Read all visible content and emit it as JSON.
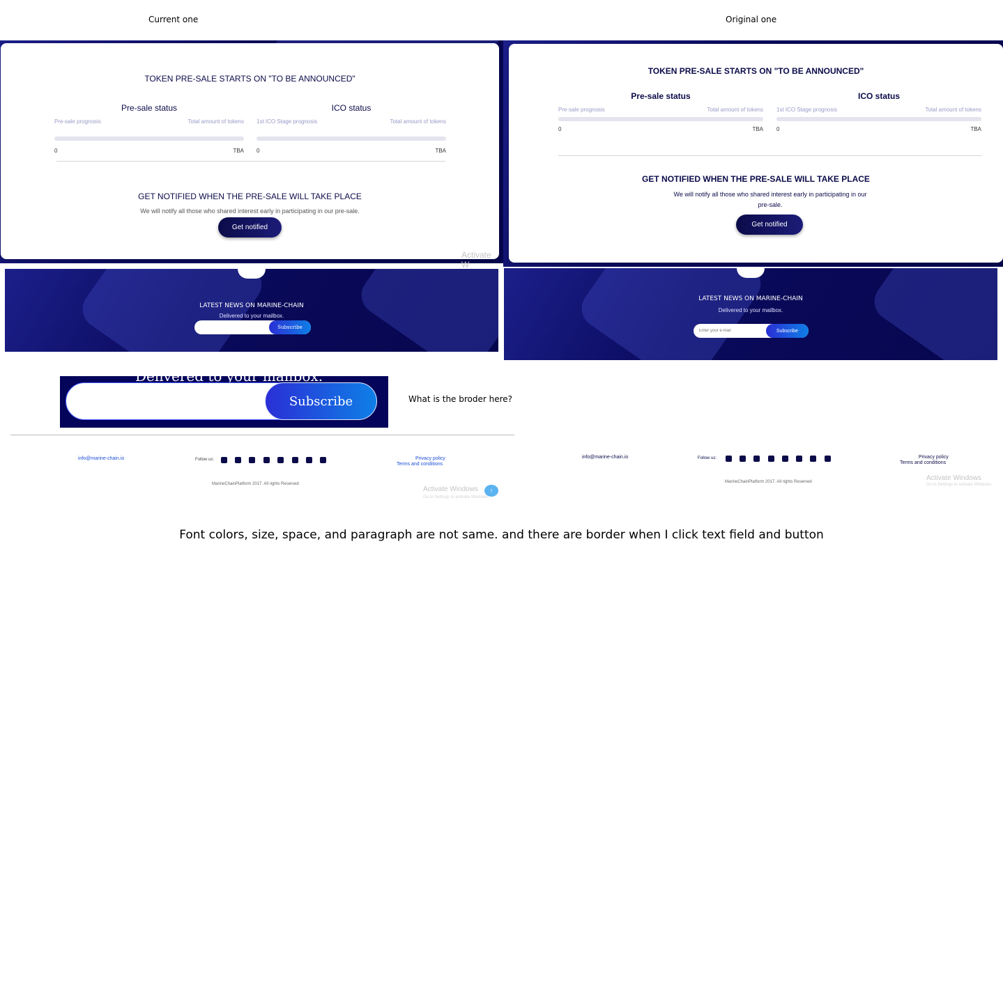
{
  "labels": {
    "current": "Current one",
    "original": "Original one"
  },
  "current": {
    "token_title": "TOKEN PRE-SALE STARTS ON \"TO BE ANNOUNCED\"",
    "presale": {
      "name": "Pre-sale status",
      "left": "Pre-sale prognosis",
      "right": "Total amount of tokens",
      "start": "0",
      "end": "TBA"
    },
    "ico": {
      "name": "ICO status",
      "left": "1st ICO Stage prognosis",
      "right": "Total amount of tokens",
      "start": "0",
      "end": "TBA"
    },
    "notify_title": "GET NOTIFIED WHEN THE PRE-SALE WILL TAKE PLACE",
    "notify_text": "We will notify all those who shared interest early in participating in our pre-sale.",
    "notify_button": "Get notified",
    "watermark": "Activate W",
    "news_title": "LATEST NEWS ON MARINE-CHAIN",
    "news_sub": "Delivered to your mailbox.",
    "subscribe": "Subscribe",
    "footer": {
      "email": "info@marine-chain.io",
      "follow": "Follow us:",
      "privacy": "Privacy policy",
      "terms": "Terms and conditions",
      "copyright": "MarineChainPlatform 2017. All rights Reserved",
      "watermark": "Activate Windows",
      "watermark_sub": "Go to Settings to activate Windows.",
      "badge": "↑"
    }
  },
  "original": {
    "token_title": "TOKEN PRE-SALE STARTS ON \"TO BE ANNOUNCED\"",
    "presale": {
      "name": "Pre-sale status",
      "left": "Pre-sale prognosis",
      "right": "Total amount of tokens",
      "start": "0",
      "end": "TBA"
    },
    "ico": {
      "name": "ICO status",
      "left": "1st ICO Stage prognosis",
      "right": "Total amount of tokens",
      "start": "0",
      "end": "TBA"
    },
    "notify_title": "GET NOTIFIED WHEN THE PRE-SALE WILL TAKE PLACE",
    "notify_text": "We will notify all those who shared interest early in participating in our pre-sale.",
    "notify_button": "Get notified",
    "news_title": "LATEST NEWS ON MARINE-CHAIN",
    "news_sub": "Delivered to your mailbox.",
    "input_placeholder": "Enter your e-mail",
    "subscribe": "Subscribe",
    "footer": {
      "email": "info@marine-chain.io",
      "follow": "Follow us:",
      "privacy": "Privacy policy",
      "terms": "Terms and conditions",
      "copyright": "MarineChainPlatform 2017. All rights Reserved",
      "watermark": "Activate Windows",
      "watermark_sub": "Go to Settings to activate Windows."
    }
  },
  "zoom": {
    "text": "Delivered to your mailbox.",
    "subscribe": "Subscribe"
  },
  "question": "What is the broder here?",
  "caption": "Font colors, size, space, and paragraph are not same. and there are border when I click text field and button",
  "social_icons": [
    "linkedin-icon",
    "medium-icon",
    "twitter-icon",
    "facebook-icon",
    "telegram-icon",
    "github-icon",
    "slack-icon",
    "youtube-icon"
  ],
  "colors": {
    "navy": "#0b0b4a",
    "accent": "#2a2fd6",
    "link": "#1d4ed8"
  }
}
